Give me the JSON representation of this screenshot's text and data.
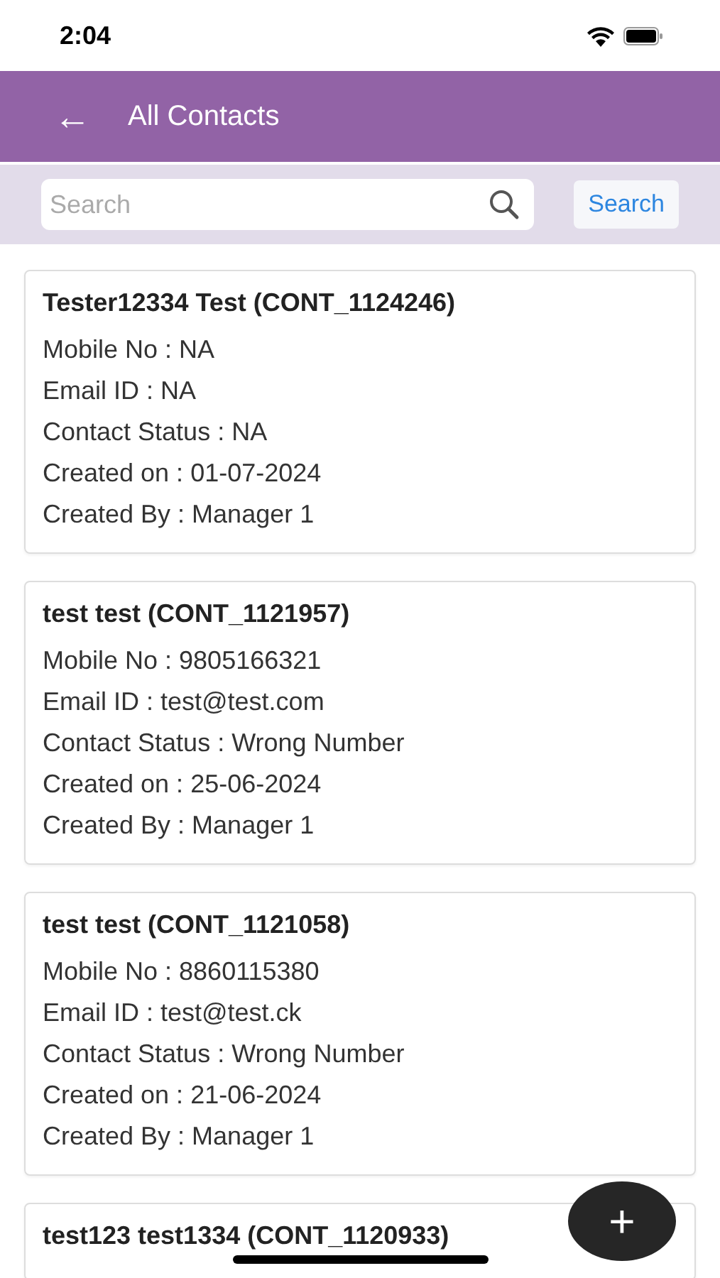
{
  "status_bar": {
    "time": "2:04"
  },
  "header": {
    "back": "←",
    "title": "All Contacts"
  },
  "search": {
    "placeholder": "Search",
    "button": "Search"
  },
  "contacts": [
    {
      "title": "Tester12334 Test (CONT_1124246)",
      "lines": [
        "Mobile No : NA",
        "Email ID : NA",
        "Contact Status : NA",
        "Created on : 01-07-2024",
        "Created By : Manager 1"
      ]
    },
    {
      "title": "test test (CONT_1121957)",
      "lines": [
        "Mobile No : 9805166321",
        "Email ID : test@test.com",
        "Contact Status : Wrong Number",
        "Created on : 25-06-2024",
        "Created By : Manager 1"
      ]
    },
    {
      "title": "test test (CONT_1121058)",
      "lines": [
        "Mobile No : 8860115380",
        "Email ID : test@test.ck",
        "Contact Status : Wrong Number",
        "Created on : 21-06-2024",
        "Created By : Manager 1"
      ]
    },
    {
      "title": "test123 test1334 (CONT_1120933)"
    }
  ],
  "fab": {
    "label": "+"
  }
}
